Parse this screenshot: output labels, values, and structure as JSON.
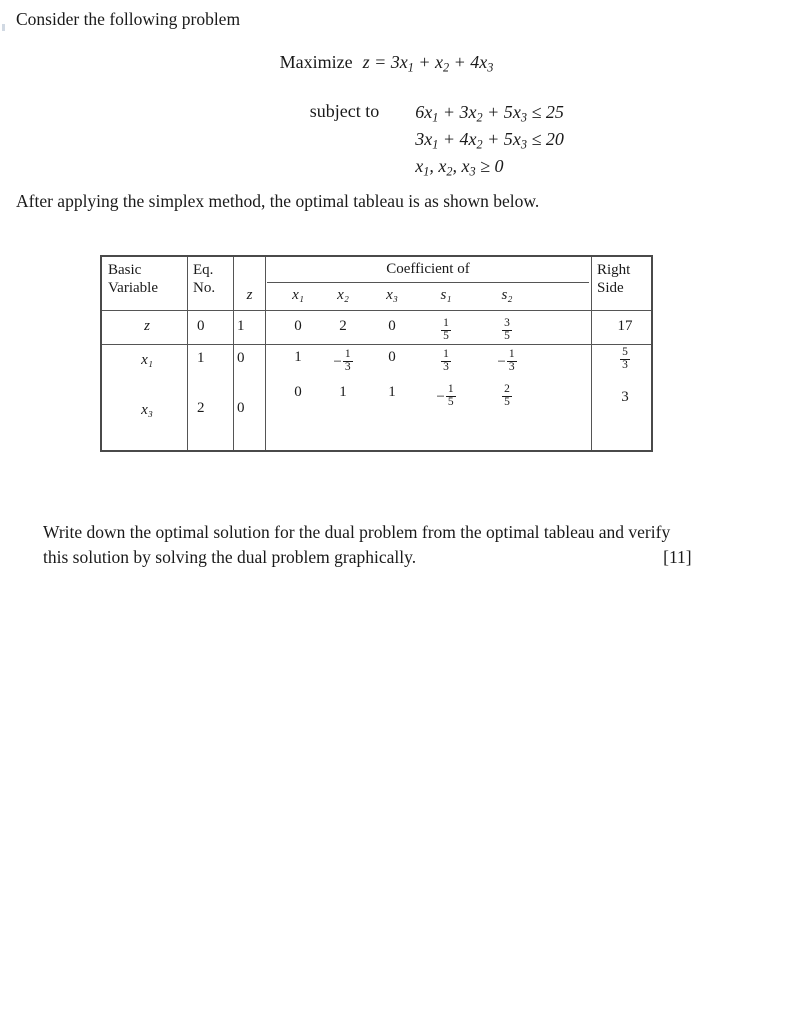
{
  "document": {
    "intro": "Consider the following problem",
    "objective": {
      "label": "Maximize",
      "expression": "z = 3x₁ + x₂ + 4x₃"
    },
    "subject_to_label": "subject to",
    "constraints": [
      "6x₁ + 3x₂ + 5x₃ ≤ 25",
      "3x₁ + 4x₂ + 5x₃ ≤ 20",
      "x₁, x₂, x₃ ≥ 0"
    ],
    "after_text": "After applying the simplex method, the optimal tableau is as shown below.",
    "closing_line1": "Write down the optimal solution for the dual problem from the optimal tableau and verify",
    "closing_line2": "this solution by solving the dual problem graphically.",
    "marks": "[11]"
  },
  "tableau": {
    "headers": {
      "basic_variable": "Basic Variable",
      "basic_variable_l1": "Basic",
      "basic_variable_l2": "Variable",
      "eq_no": "Eq. No.",
      "eq_no_l1": "Eq.",
      "eq_no_l2": "No.",
      "coefficient_of": "Coefficient of",
      "right_side": "Right Side",
      "right_side_l1": "Right",
      "right_side_l2": "Side",
      "columns": [
        "z",
        "x₁",
        "x₂",
        "x₃",
        "s₁",
        "s₂"
      ]
    },
    "rows": [
      {
        "basic_variable": "z",
        "eq_no": "0",
        "z": "1",
        "x1": "0",
        "x2": "2",
        "x3": "0",
        "s1": {
          "sign": "",
          "num": "1",
          "den": "5"
        },
        "s2": {
          "sign": "",
          "num": "3",
          "den": "5"
        },
        "right_side": "17"
      },
      {
        "basic_variable": "x₁",
        "eq_no": "1",
        "z": "0",
        "x1": "1",
        "x2": {
          "sign": "−",
          "num": "1",
          "den": "3"
        },
        "x3": "0",
        "s1": {
          "sign": "",
          "num": "1",
          "den": "3"
        },
        "s2": {
          "sign": "−",
          "num": "1",
          "den": "3"
        },
        "right_side": {
          "sign": "",
          "num": "5",
          "den": "3"
        }
      },
      {
        "basic_variable": "x₃",
        "eq_no": "2",
        "z": "0",
        "x1": "0",
        "x2": "1",
        "x3": "1",
        "s1": {
          "sign": "−",
          "num": "1",
          "den": "5"
        },
        "s2": {
          "sign": "",
          "num": "2",
          "den": "5"
        },
        "right_side": "3"
      }
    ]
  },
  "style": {
    "text_color": "#1a1a1a",
    "border_color": "#4a4a4a",
    "rule_color": "#555555",
    "background": "#ffffff"
  }
}
